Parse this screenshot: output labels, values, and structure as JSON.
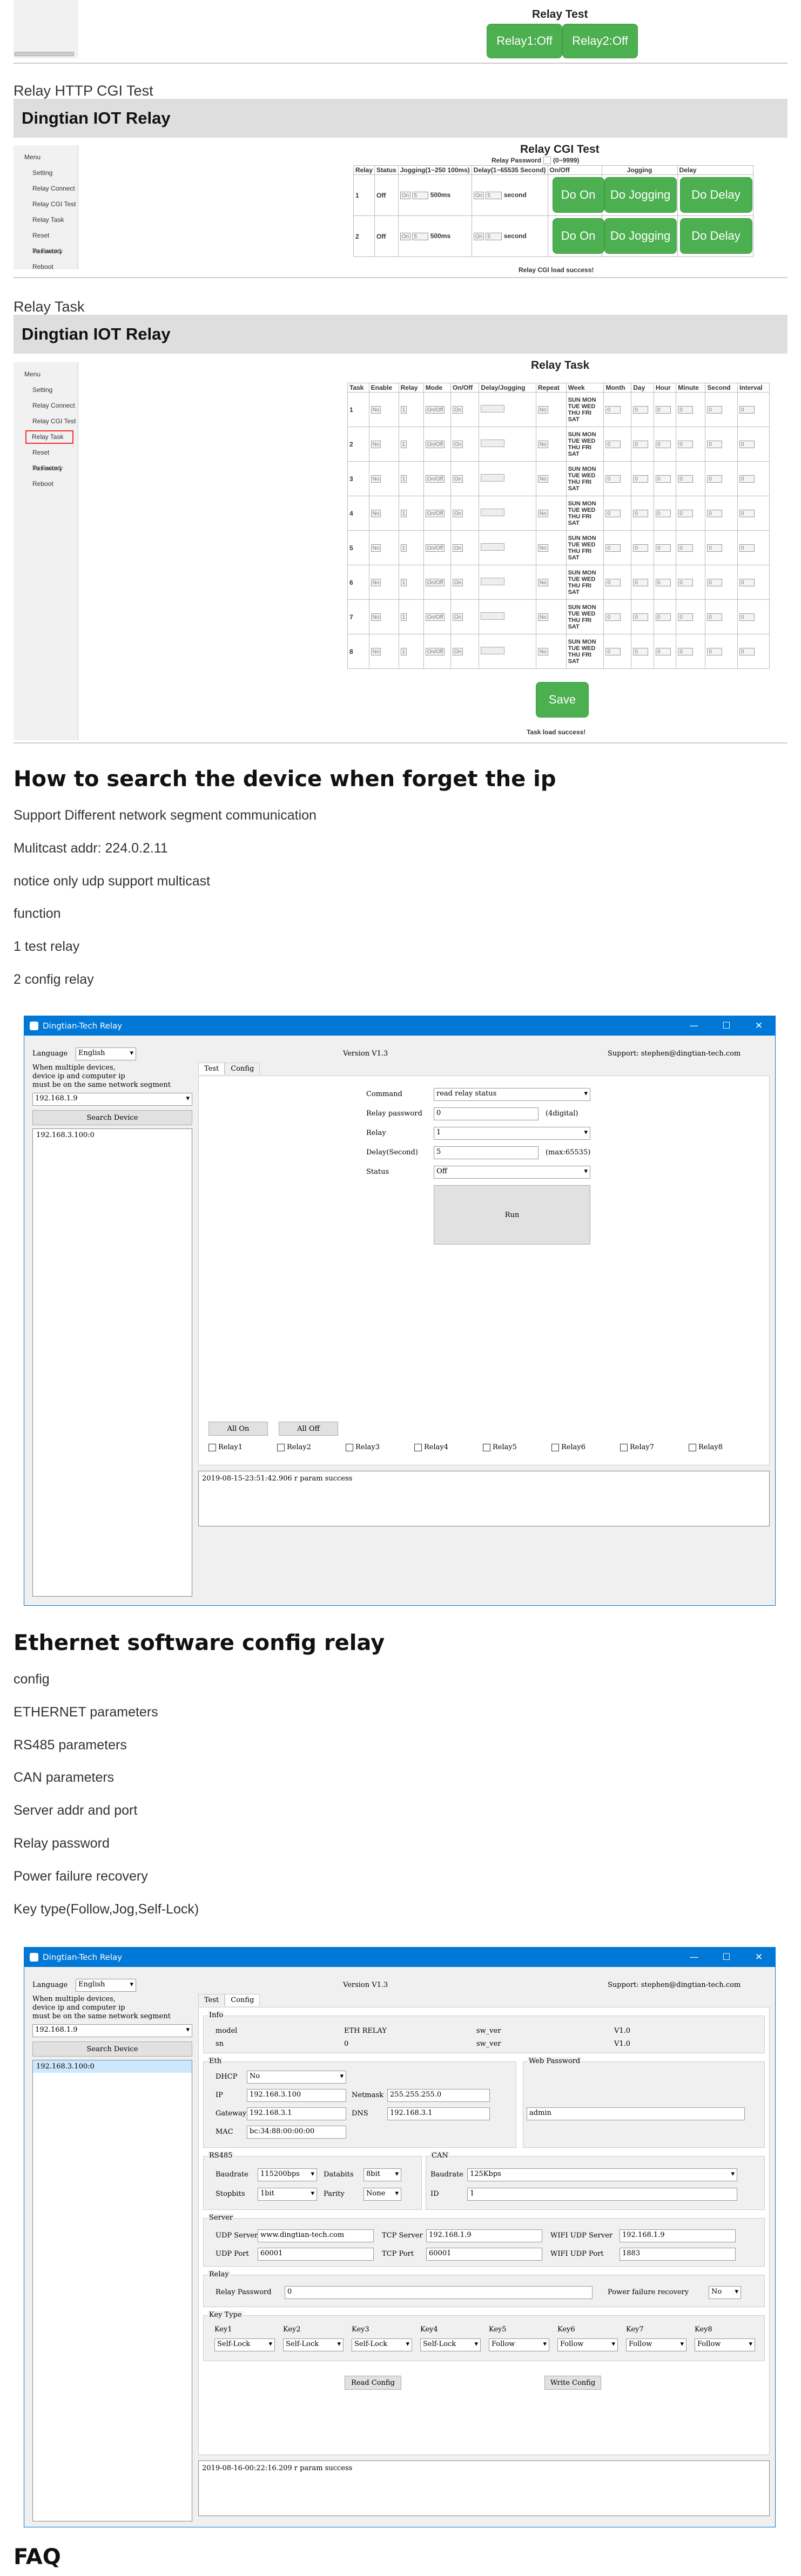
{
  "relay_test": {
    "title": "Relay Test",
    "buttons": [
      "Relay1:Off",
      "Relay2:Off"
    ]
  },
  "cgi_section": {
    "heading": "Relay HTTP CGI Test",
    "banner": "Dingtian IOT Relay",
    "menu": [
      "Menu",
      "Setting",
      "Relay Connect",
      "Relay CGI Test",
      "Relay Task",
      "Reset Password",
      "To Factory",
      "Reboot"
    ],
    "page_title": "Relay CGI Test",
    "password_label": "Relay Password",
    "password_hint": "(0~9999)",
    "headers": [
      "Relay",
      "Status",
      "Jogging(1~250 100ms)",
      "Delay(1~65535 Second)",
      "On/Off",
      "Jogging",
      "Delay"
    ],
    "rows": [
      {
        "relay": "1",
        "status": "Off",
        "jog_sel": "On",
        "jog_val": "5",
        "jog_unit": "500ms",
        "delay_sel": "On",
        "delay_val": "5",
        "delay_unit": "second"
      },
      {
        "relay": "2",
        "status": "Off",
        "jog_sel": "On",
        "jog_val": "5",
        "jog_unit": "500ms",
        "delay_sel": "On",
        "delay_val": "5",
        "delay_unit": "second"
      }
    ],
    "btn_on": "Do On",
    "btn_jog": "Do Jogging",
    "btn_delay": "Do Delay",
    "status_msg": "Relay CGI load success!"
  },
  "task_section": {
    "heading": "Relay Task",
    "banner": "Dingtian IOT Relay",
    "menu": [
      "Menu",
      "Setting",
      "Relay Connect",
      "Relay CGI Test",
      "Relay Task",
      "Reset Password",
      "To Factory",
      "Reboot"
    ],
    "page_title": "Relay Task",
    "headers": [
      "Task",
      "Enable",
      "Relay",
      "Mode",
      "On/Off",
      "Delay/Jogging",
      "Repeat",
      "Week",
      "Month",
      "Day",
      "Hour",
      "Minute",
      "Second",
      "Interval"
    ],
    "tasks": [
      "1",
      "2",
      "3",
      "4",
      "5",
      "6",
      "7",
      "8"
    ],
    "enable_val": "No",
    "relay_val": "1",
    "mode_val": "On/Off",
    "onoff_val": "On",
    "repeat_val": "No",
    "week_text": "SUN MON TUE WED THU FRI SAT",
    "num_val": "0",
    "save_label": "Save",
    "status_msg": "Task load success!"
  },
  "doc1": {
    "heading": "How to search the device when forget the ip",
    "lines": [
      "Support Different network segment communication",
      "Mulitcast addr: 224.0.2.11",
      "notice only udp support multicast",
      "function",
      "1 test relay",
      "2 config relay"
    ]
  },
  "win1": {
    "title": "Dingtian-Tech Relay",
    "controls": [
      "—",
      "☐",
      "✕"
    ],
    "language_label": "Language",
    "language_val": "English",
    "hint": "When multiple devices,\ndevice ip and computer ip\nmust be on the same network segment",
    "ip_val": "192.168.1.9",
    "search_label": "Search Device",
    "device_item": "192.168.3.100:0",
    "version": "Version V1.3",
    "support": "Support: stephen@dingtian-tech.com",
    "tabs": [
      "Test",
      "Config"
    ],
    "command_label": "Command",
    "command_val": "read relay status",
    "password_label": "Relay password",
    "password_val": "0",
    "password_hint": "(4digital)",
    "relay_label": "Relay",
    "relay_val": "1",
    "delay_label": "Delay(Second)",
    "delay_val": "5",
    "delay_hint": "(max:65535)",
    "status_label": "Status",
    "status_val": "Off",
    "run_label": "Run",
    "all_on": "All On",
    "all_off": "All Off",
    "relays": [
      "Relay1",
      "Relay2",
      "Relay3",
      "Relay4",
      "Relay5",
      "Relay6",
      "Relay7",
      "Relay8"
    ],
    "log": "2019-08-15-23:51:42.906 r param success"
  },
  "doc2": {
    "heading": "Ethernet software config relay",
    "lines": [
      "config",
      "ETHERNET parameters",
      "RS485 parameters",
      "CAN parameters",
      "Server addr and port",
      "Relay password",
      "Power failure recovery",
      "Key type(Follow,Jog,Self-Lock)"
    ]
  },
  "win2": {
    "title": "Dingtian-Tech Relay",
    "controls": [
      "—",
      "☐",
      "✕"
    ],
    "language_label": "Language",
    "language_val": "English",
    "hint": "When multiple devices,\ndevice ip and computer ip\nmust be on the same network segment",
    "ip_val": "192.168.1.9",
    "search_label": "Search Device",
    "device_item": "192.168.3.100:0",
    "version": "Version V1.3",
    "support": "Support: stephen@dingtian-tech.com",
    "tabs": [
      "Test",
      "Config"
    ],
    "info": {
      "title": "Info",
      "model_label": "model",
      "model_val": "ETH RELAY",
      "sn_label": "sn",
      "sn_val": "0",
      "sw_label": "sw_ver",
      "sw_val": "V1.0",
      "hw_label": "sw_ver",
      "hw_val": "V1.0"
    },
    "eth": {
      "title": "Eth",
      "dhcp_label": "DHCP",
      "dhcp_val": "No",
      "ip_label": "IP",
      "ip_val": "192.168.3.100",
      "netmask_label": "Netmask",
      "netmask_val": "255.255.255.0",
      "gateway_label": "Gateway",
      "gateway_val": "192.168.3.1",
      "dns_label": "DNS",
      "dns_val": "192.168.3.1",
      "mac_label": "MAC",
      "mac_val": "bc:34:88:00:00:00"
    },
    "webpw": {
      "title": "Web Password",
      "val": "admin"
    },
    "rs485": {
      "title": "RS485",
      "baud_label": "Baudrate",
      "baud_val": "115200bps",
      "data_label": "Databits",
      "data_val": "8bit",
      "stop_label": "Stopbits",
      "stop_val": "1bit",
      "parity_label": "Parity",
      "parity_val": "None"
    },
    "can": {
      "title": "CAN",
      "baud_label": "Baudrate",
      "baud_val": "125Kbps",
      "id_label": "ID",
      "id_val": "1"
    },
    "server": {
      "title": "Server",
      "udp_server_label": "UDP Server",
      "udp_server_val": "www.dingtian-tech.com",
      "tcp_server_label": "TCP Server",
      "tcp_server_val": "192.168.1.9",
      "wifi_udp_label": "WIFI UDP Server",
      "wifi_udp_val": "192.168.1.9",
      "udp_port_label": "UDP Port",
      "udp_port_val": "60001",
      "tcp_port_label": "TCP Port",
      "tcp_port_val": "60001",
      "wifi_port_label": "WIFI UDP Port",
      "wifi_port_val": "1883"
    },
    "relay": {
      "title": "Relay",
      "pw_label": "Relay Password",
      "pw_val": "0",
      "pfr_label": "Power failure recovery",
      "pfr_val": "No"
    },
    "keytype": {
      "title": "Key Type",
      "keys": [
        "Key1",
        "Key2",
        "Key3",
        "Key4",
        "Key5",
        "Key6",
        "Key7",
        "Key8"
      ],
      "vals": [
        "Self-Lock",
        "Self-Lock",
        "Self-Lock",
        "Self-Lock",
        "Follow",
        "Follow",
        "Follow",
        "Follow"
      ]
    },
    "read_config": "Read Config",
    "write_config": "Write Config",
    "log": "2019-08-16-00:22:16.209 r param success"
  },
  "faq": {
    "heading": "FAQ"
  },
  "colors": {
    "green": "#4caf50",
    "win_blue": "#0078d7",
    "banner": "#dedede"
  }
}
